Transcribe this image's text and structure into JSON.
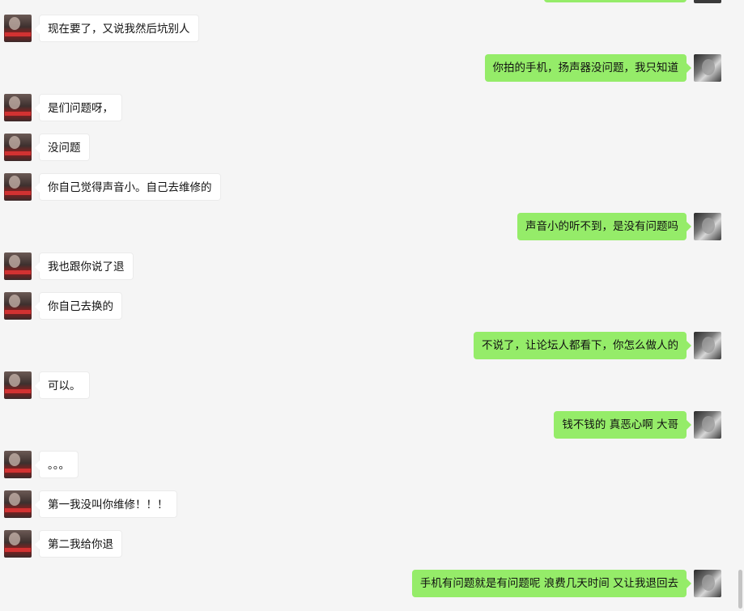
{
  "messages": [
    {
      "side": "left",
      "text": "现在要了，又说我然后坑别人"
    },
    {
      "side": "right",
      "text": "你拍的手机，扬声器没问题，我只知道"
    },
    {
      "side": "left",
      "text": "是们问题呀，"
    },
    {
      "side": "left",
      "text": "没问题"
    },
    {
      "side": "left",
      "text": "你自己觉得声音小。自己去维修的"
    },
    {
      "side": "right",
      "text": "声音小的听不到，是没有问题吗"
    },
    {
      "side": "left",
      "text": "我也跟你说了退"
    },
    {
      "side": "left",
      "text": "你自己去换的"
    },
    {
      "side": "right",
      "text": "不说了，让论坛人都看下，你怎么做人的"
    },
    {
      "side": "left",
      "text": "可以。"
    },
    {
      "side": "right",
      "text": "钱不钱的  真恶心啊  大哥"
    },
    {
      "side": "left",
      "text": "。。。"
    },
    {
      "side": "left",
      "text": "第一我没叫你维修！！！"
    },
    {
      "side": "left",
      "text": "第二我给你退"
    },
    {
      "side": "right",
      "text": "手机有问题就是有问题呢 浪费几天时间 又让我退回去"
    }
  ]
}
